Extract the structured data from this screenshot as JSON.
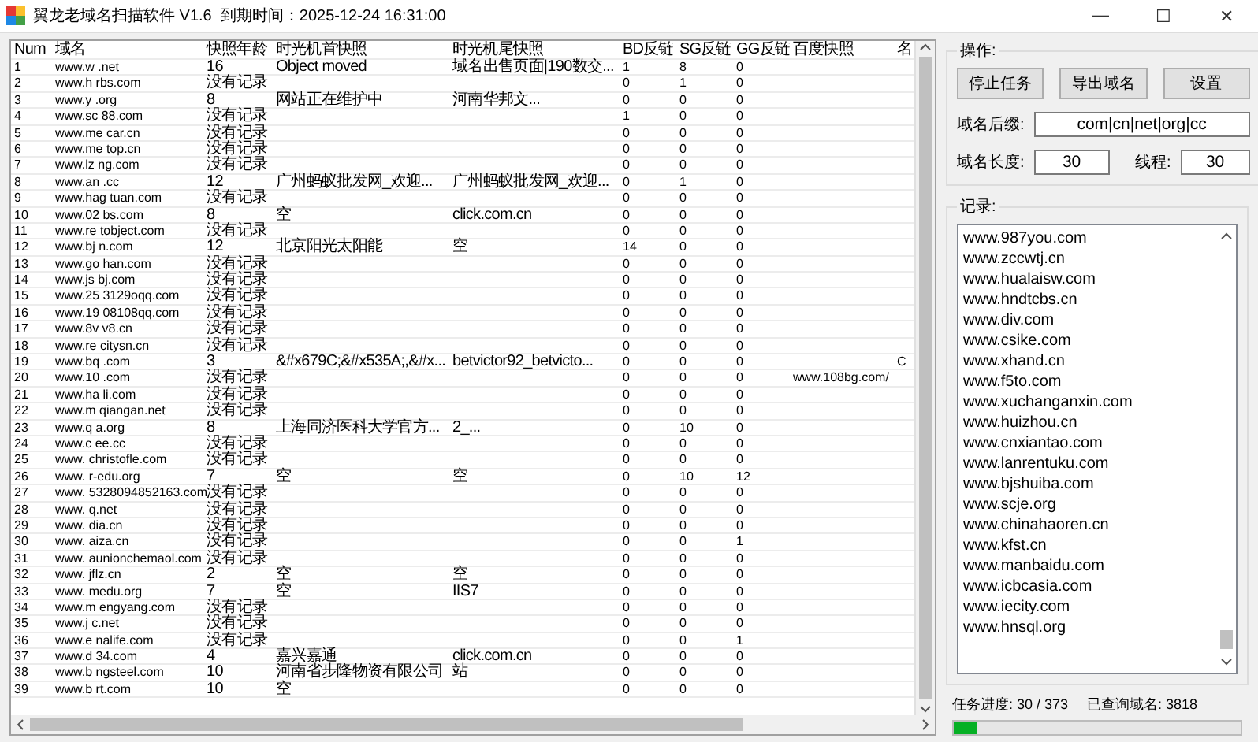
{
  "window": {
    "title": "翼龙老域名扫描软件 V1.6  到期时间：2025-12-24 16:31:00",
    "controls": [
      "—",
      "☐",
      "✕"
    ]
  },
  "table": {
    "columns": [
      "Num",
      "域名",
      "快照年龄",
      "时光机首快照",
      "时光机尾快照",
      "BD反链",
      "SG反链",
      "GG反链",
      "百度快照",
      "名"
    ],
    "rows": [
      [
        "1",
        "www.w  .net",
        "16",
        "Object moved",
        "域名出售页面|190数交...",
        "1",
        "8",
        "0",
        "",
        ""
      ],
      [
        "2",
        "www.h  rbs.com",
        "没有记录",
        "",
        "",
        "0",
        "1",
        "0",
        "",
        ""
      ],
      [
        "3",
        "www.y  .org",
        "8",
        "网站正在维护中",
        "河南华邦文...",
        "0",
        "0",
        "0",
        "",
        ""
      ],
      [
        "4",
        "www.sc  88.com",
        "没有记录",
        "",
        "",
        "1",
        "0",
        "0",
        "",
        ""
      ],
      [
        "5",
        "www.me  car.cn",
        "没有记录",
        "",
        "",
        "0",
        "0",
        "0",
        "",
        ""
      ],
      [
        "6",
        "www.me  top.cn",
        "没有记录",
        "",
        "",
        "0",
        "0",
        "0",
        "",
        ""
      ],
      [
        "7",
        "www.lz  ng.com",
        "没有记录",
        "",
        "",
        "0",
        "0",
        "0",
        "",
        ""
      ],
      [
        "8",
        "www.an  .cc",
        "12",
        "广州蚂蚁批发网_欢迎...",
        "广州蚂蚁批发网_欢迎...",
        "0",
        "1",
        "0",
        "",
        ""
      ],
      [
        "9",
        "www.hag  tuan.com",
        "没有记录",
        "",
        "",
        "0",
        "0",
        "0",
        "",
        ""
      ],
      [
        "10",
        "www.02  bs.com",
        "8",
        "空",
        "click.com.cn",
        "0",
        "0",
        "0",
        "",
        ""
      ],
      [
        "11",
        "www.re  tobject.com",
        "没有记录",
        "",
        "",
        "0",
        "0",
        "0",
        "",
        ""
      ],
      [
        "12",
        "www.bj  n.com",
        "12",
        "北京阳光太阳能",
        "空",
        "14",
        "0",
        "0",
        "",
        ""
      ],
      [
        "13",
        "www.go  han.com",
        "没有记录",
        "",
        "",
        "0",
        "0",
        "0",
        "",
        ""
      ],
      [
        "14",
        "www.js  bj.com",
        "没有记录",
        "",
        "",
        "0",
        "0",
        "0",
        "",
        ""
      ],
      [
        "15",
        "www.25  3129oqq.com",
        "没有记录",
        "",
        "",
        "0",
        "0",
        "0",
        "",
        ""
      ],
      [
        "16",
        "www.19  08108qq.com",
        "没有记录",
        "",
        "",
        "0",
        "0",
        "0",
        "",
        ""
      ],
      [
        "17",
        "www.8v  v8.cn",
        "没有记录",
        "",
        "",
        "0",
        "0",
        "0",
        "",
        ""
      ],
      [
        "18",
        "www.re  citysn.cn",
        "没有记录",
        "",
        "",
        "0",
        "0",
        "0",
        "",
        ""
      ],
      [
        "19",
        "www.bq  .com",
        "3",
        "&#x679C;&#x535A;,&#x...",
        "betvictor92_betvicto...",
        "0",
        "0",
        "0",
        "",
        "C"
      ],
      [
        "20",
        "www.10  .com",
        "没有记录",
        "",
        "",
        "0",
        "0",
        "0",
        "www.108bg.com/",
        ""
      ],
      [
        "21",
        "www.ha  li.com",
        "没有记录",
        "",
        "",
        "0",
        "0",
        "0",
        "",
        ""
      ],
      [
        "22",
        "www.m  qiangan.net",
        "没有记录",
        "",
        "",
        "0",
        "0",
        "0",
        "",
        ""
      ],
      [
        "23",
        "www.q  a.org",
        "8",
        "上海同济医科大学官方...",
        "2_...",
        "0",
        "10",
        "0",
        "",
        ""
      ],
      [
        "24",
        "www.c  ee.cc",
        "没有记录",
        "",
        "",
        "0",
        "0",
        "0",
        "",
        ""
      ],
      [
        "25",
        "www.  christofle.com",
        "没有记录",
        "",
        "",
        "0",
        "0",
        "0",
        "",
        ""
      ],
      [
        "26",
        "www.  r-edu.org",
        "7",
        "空",
        "空",
        "0",
        "10",
        "12",
        "",
        ""
      ],
      [
        "27",
        "www.  5328094852163.com",
        "没有记录",
        "",
        "",
        "0",
        "0",
        "0",
        "",
        ""
      ],
      [
        "28",
        "www.  q.net",
        "没有记录",
        "",
        "",
        "0",
        "0",
        "0",
        "",
        ""
      ],
      [
        "29",
        "www.  dia.cn",
        "没有记录",
        "",
        "",
        "0",
        "0",
        "0",
        "",
        ""
      ],
      [
        "30",
        "www.  aiza.cn",
        "没有记录",
        "",
        "",
        "0",
        "0",
        "1",
        "",
        ""
      ],
      [
        "31",
        "www.  aunionchemaol.com",
        "没有记录",
        "",
        "",
        "0",
        "0",
        "0",
        "",
        ""
      ],
      [
        "32",
        "www.  jflz.cn",
        "2",
        "空",
        "空",
        "0",
        "0",
        "0",
        "",
        ""
      ],
      [
        "33",
        "www.  medu.org",
        "7",
        "空",
        "IIS7",
        "0",
        "0",
        "0",
        "",
        ""
      ],
      [
        "34",
        "www.m  engyang.com",
        "没有记录",
        "",
        "",
        "0",
        "0",
        "0",
        "",
        ""
      ],
      [
        "35",
        "www.j  c.net",
        "没有记录",
        "",
        "",
        "0",
        "0",
        "0",
        "",
        ""
      ],
      [
        "36",
        "www.e  nalife.com",
        "没有记录",
        "",
        "",
        "0",
        "0",
        "1",
        "",
        ""
      ],
      [
        "37",
        "www.d  34.com",
        "4",
        "嘉兴嘉通",
        "click.com.cn",
        "0",
        "0",
        "0",
        "",
        ""
      ],
      [
        "38",
        "www.b  ngsteel.com",
        "10",
        "河南省步隆物资有限公司",
        "站",
        "0",
        "0",
        "0",
        "",
        ""
      ],
      [
        "39",
        "www.b  rt.com",
        "10",
        "空",
        "",
        "0",
        "0",
        "0",
        "",
        ""
      ]
    ]
  },
  "operations": {
    "title": "操作:",
    "buttons": [
      "停止任务",
      "导出域名",
      "设置"
    ],
    "suffix": {
      "label": "域名后缀:",
      "value": "com|cn|net|org|cc"
    },
    "length": {
      "label": "域名长度:",
      "value": "30"
    },
    "threads": {
      "label": "线程:",
      "value": "30"
    }
  },
  "log": {
    "title": "记录:",
    "items": [
      "www.987you.com",
      "www.zccwtj.cn",
      "www.hualaisw.com",
      "www.hndtcbs.cn",
      "www.div.com",
      "www.csike.com",
      "www.xhand.cn",
      "www.f5to.com",
      "www.xuchanganxin.com",
      "www.huizhou.cn",
      "www.cnxiantao.com",
      "www.lanrentuku.com",
      "www.bjshuiba.com",
      "www.scje.org",
      "www.chinahaoren.cn",
      "www.kfst.cn",
      "www.manbaidu.com",
      "www.icbcasia.com",
      "www.iecity.com",
      "www.hnsql.org"
    ]
  },
  "status": {
    "progress_label": "任务进度: 30 / 373",
    "queried_label": "已查询域名: 3818",
    "level": 0.08
  }
}
